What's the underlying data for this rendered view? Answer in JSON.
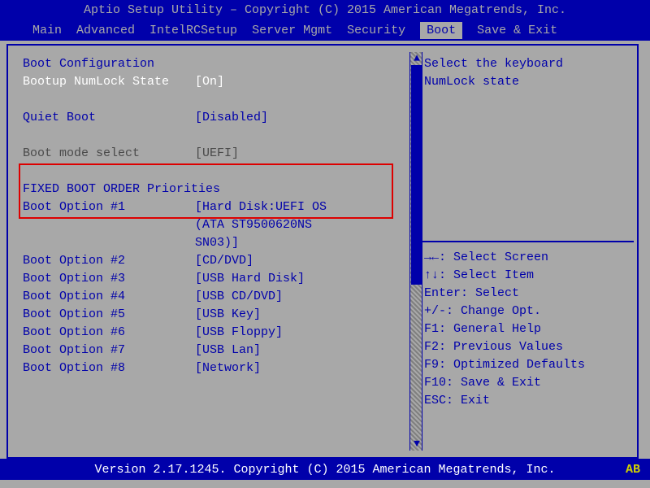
{
  "title": "Aptio Setup Utility – Copyright (C) 2015 American Megatrends, Inc.",
  "menu": {
    "items": [
      "Main",
      "Advanced",
      "IntelRCSetup",
      "Server Mgmt",
      "Security",
      "Boot",
      "Save & Exit"
    ],
    "active_index": 5
  },
  "panel": {
    "section_title_1": "Boot Configuration",
    "numlock": {
      "label": "Bootup NumLock State",
      "value": "[On]"
    },
    "quiet_boot": {
      "label": "Quiet Boot",
      "value": "[Disabled]"
    },
    "boot_mode": {
      "label": "Boot mode select",
      "value": "[UEFI]"
    },
    "section_title_2": "FIXED BOOT ORDER Priorities",
    "boot_options": [
      {
        "label": "Boot Option #1",
        "value_line1": "[Hard Disk:UEFI OS",
        "value_line2": "(ATA     ST9500620NS",
        "value_line3": "   SN03)]"
      },
      {
        "label": "Boot Option #2",
        "value": "[CD/DVD]"
      },
      {
        "label": "Boot Option #3",
        "value": "[USB Hard Disk]"
      },
      {
        "label": "Boot Option #4",
        "value": "[USB CD/DVD]"
      },
      {
        "label": "Boot Option #5",
        "value": "[USB Key]"
      },
      {
        "label": "Boot Option #6",
        "value": "[USB Floppy]"
      },
      {
        "label": "Boot Option #7",
        "value": "[USB Lan]"
      },
      {
        "label": "Boot Option #8",
        "value": "[Network]"
      }
    ]
  },
  "help": {
    "line1": "Select the keyboard",
    "line2": "NumLock state"
  },
  "keys": [
    "→←: Select Screen",
    "↑↓: Select Item",
    "Enter: Select",
    "+/-: Change Opt.",
    "F1: General Help",
    "F2: Previous Values",
    "F9: Optimized Defaults",
    "F10: Save & Exit",
    "ESC: Exit"
  ],
  "footer": {
    "version": "Version 2.17.1245. Copyright (C) 2015 American Megatrends, Inc.",
    "marker": "AB"
  }
}
